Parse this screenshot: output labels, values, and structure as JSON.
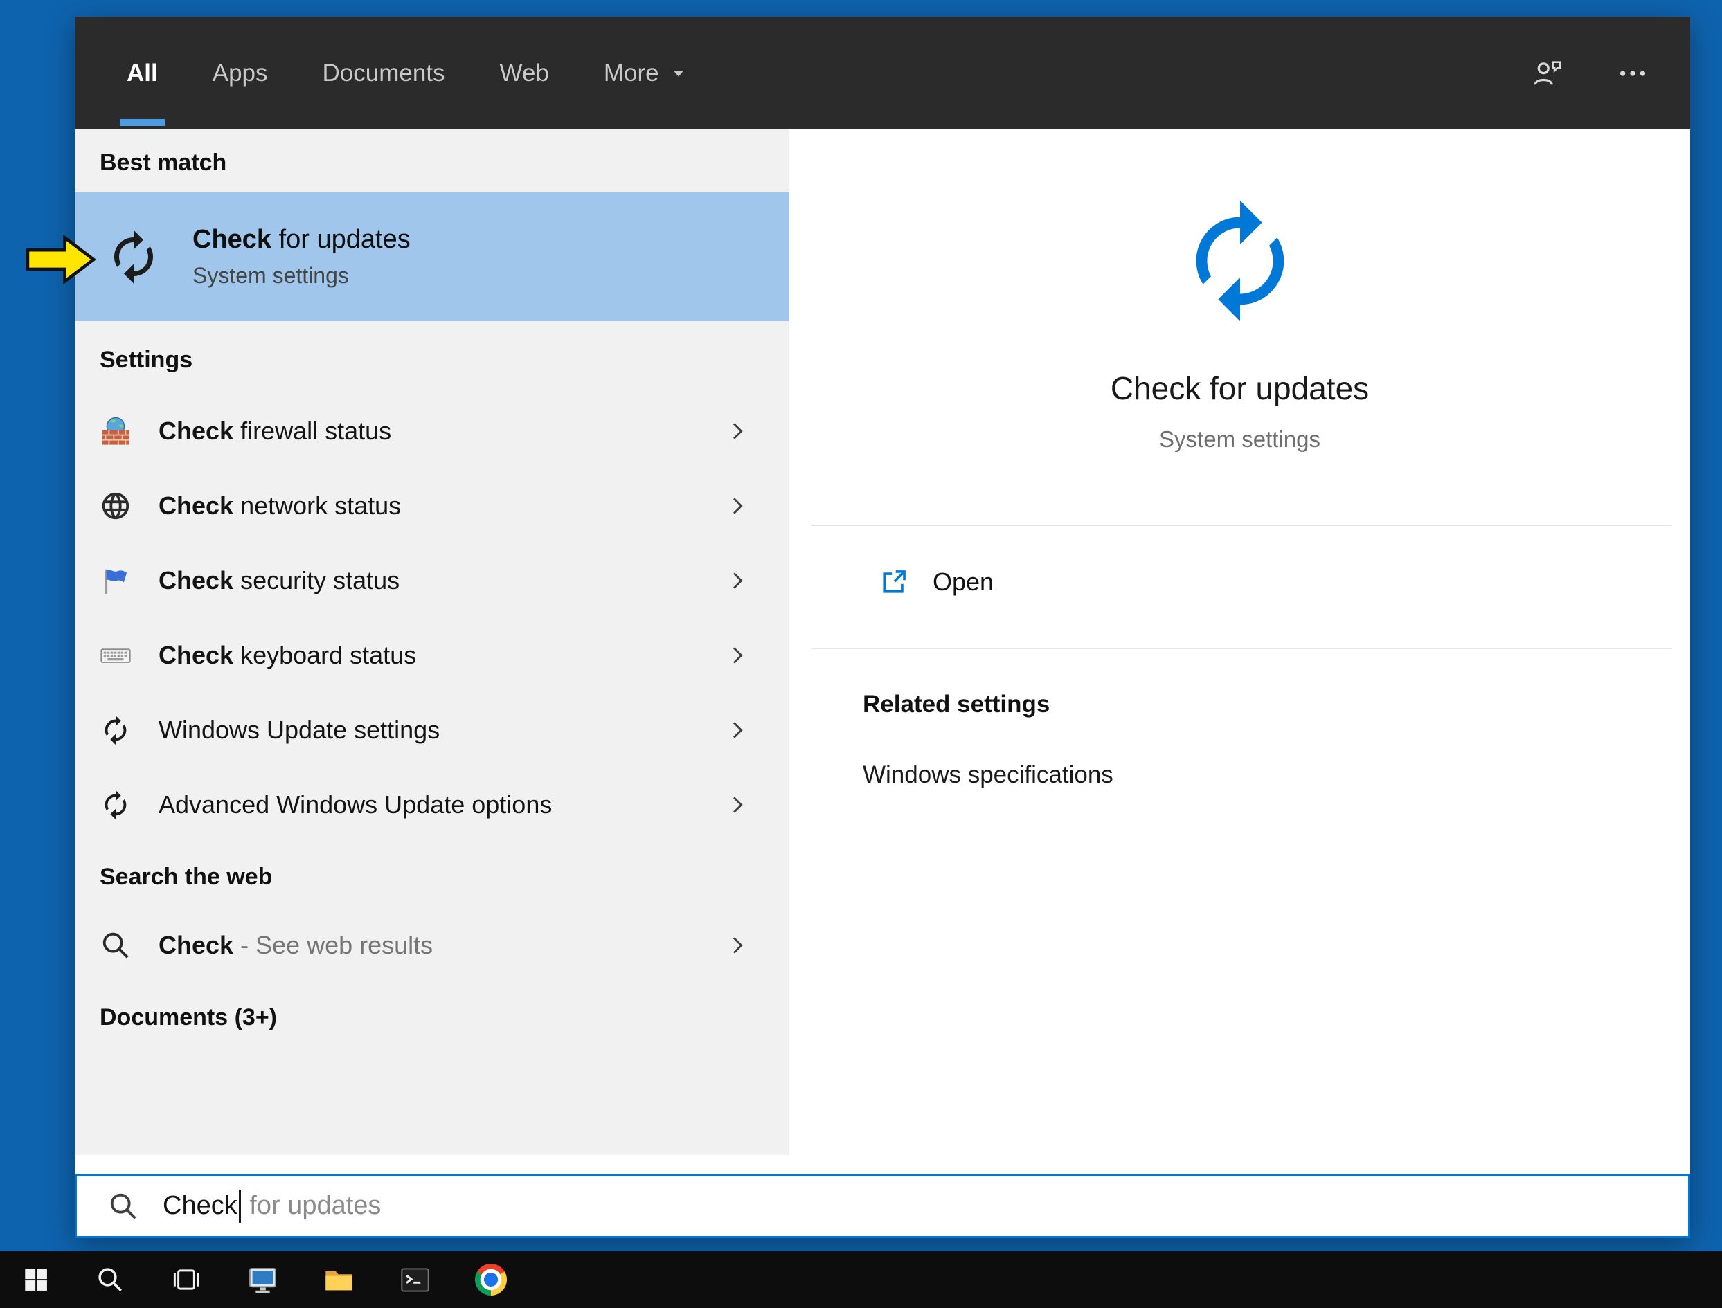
{
  "colors": {
    "desktop": "#0e63ae",
    "accent": "#0078d7",
    "topbar": "#2b2b2b",
    "highlight": "#a1c6eb"
  },
  "topbar": {
    "tabs": [
      {
        "label": "All"
      },
      {
        "label": "Apps"
      },
      {
        "label": "Documents"
      },
      {
        "label": "Web"
      },
      {
        "label": "More"
      }
    ]
  },
  "left_panel": {
    "best_match_header": "Best match",
    "best_match": {
      "title_match": "Check",
      "title_rest": " for updates",
      "subtitle": "System settings"
    },
    "settings_header": "Settings",
    "settings_items": [
      {
        "match": "Check",
        "rest": " firewall status",
        "icon": "firewall-icon"
      },
      {
        "match": "Check",
        "rest": " network status",
        "icon": "globe-icon"
      },
      {
        "match": "Check",
        "rest": " security status",
        "icon": "flag-icon"
      },
      {
        "match": "Check",
        "rest": " keyboard status",
        "icon": "keyboard-icon"
      },
      {
        "match": "",
        "rest": "Windows Update settings",
        "icon": "sync-icon"
      },
      {
        "match": "",
        "rest": "Advanced Windows Update options",
        "icon": "sync-icon"
      }
    ],
    "web_header": "Search the web",
    "web_item": {
      "match": "Check",
      "rest": " - See web results",
      "icon": "search-icon"
    },
    "documents_header": "Documents (3+)"
  },
  "right_panel": {
    "title": "Check for updates",
    "subtitle": "System settings",
    "open_label": "Open",
    "related_header": "Related settings",
    "related_link": "Windows specifications"
  },
  "search_box": {
    "typed": "Check",
    "suggestion": " for updates"
  }
}
